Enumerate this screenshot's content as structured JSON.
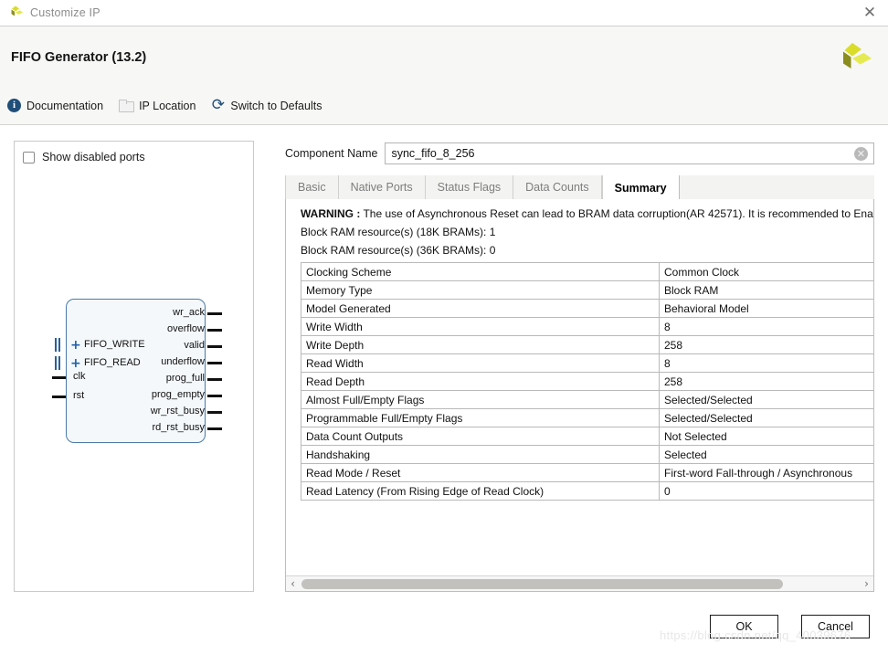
{
  "window": {
    "title": "Customize IP",
    "close_label": "✕",
    "app_icon": "xilinx-logo-icon"
  },
  "header": {
    "ip_title": "FIFO Generator (13.2)",
    "logo": "xilinx-logo-icon",
    "toolbar": [
      {
        "label": "Documentation",
        "icon": "info-icon"
      },
      {
        "label": "IP Location",
        "icon": "folder-icon"
      },
      {
        "label": "Switch to Defaults",
        "icon": "refresh-icon"
      }
    ]
  },
  "left_panel": {
    "show_disabled_ports": {
      "label": "Show disabled ports",
      "checked": false
    },
    "symbol": {
      "left_ports": [
        {
          "name": "FIFO_WRITE",
          "type": "bus"
        },
        {
          "name": "FIFO_READ",
          "type": "bus"
        },
        {
          "name": "clk",
          "type": "pin"
        },
        {
          "name": "rst",
          "type": "pin"
        }
      ],
      "right_ports": [
        "wr_ack",
        "overflow",
        "valid",
        "underflow",
        "prog_full",
        "prog_empty",
        "wr_rst_busy",
        "rd_rst_busy"
      ]
    }
  },
  "component_name": {
    "label": "Component Name",
    "value": "sync_fifo_8_256",
    "placeholder": "",
    "clear_icon": "clear-circle-icon"
  },
  "tabs": [
    {
      "label": "Basic",
      "active": false
    },
    {
      "label": "Native Ports",
      "active": false
    },
    {
      "label": "Status Flags",
      "active": false
    },
    {
      "label": "Data Counts",
      "active": false
    },
    {
      "label": "Summary",
      "active": true
    }
  ],
  "summary": {
    "warning_prefix": "WARNING :",
    "warning_text": " The use of Asynchronous Reset can lead to BRAM data corruption(AR 42571). It is recommended to Ena",
    "bram_18k": "Block RAM resource(s) (18K BRAMs): 1",
    "bram_36k": "Block RAM resource(s) (36K BRAMs): 0",
    "rows": [
      {
        "key": "Clocking Scheme",
        "value": "Common Clock"
      },
      {
        "key": "Memory Type",
        "value": "Block RAM"
      },
      {
        "key": "Model Generated",
        "value": "Behavioral Model"
      },
      {
        "key": "Write Width",
        "value": "8"
      },
      {
        "key": "Write Depth",
        "value": "258"
      },
      {
        "key": "Read Width",
        "value": "8"
      },
      {
        "key": "Read Depth",
        "value": "258"
      },
      {
        "key": "Almost Full/Empty Flags",
        "value": "Selected/Selected"
      },
      {
        "key": "Programmable Full/Empty Flags",
        "value": "Selected/Selected"
      },
      {
        "key": "Data Count Outputs",
        "value": "Not Selected"
      },
      {
        "key": "Handshaking",
        "value": "Selected"
      },
      {
        "key": "Read Mode / Reset",
        "value": "First-word Fall-through / Asynchronous"
      },
      {
        "key": "Read Latency (From Rising Edge of Read Clock)",
        "value": "0"
      }
    ]
  },
  "scrollbar": {
    "left_arrow": "‹",
    "right_arrow": "›"
  },
  "footer": {
    "ok_label": "OK",
    "cancel_label": "Cancel"
  },
  "watermark": "https://blog.csdn.net/qq_40039676"
}
